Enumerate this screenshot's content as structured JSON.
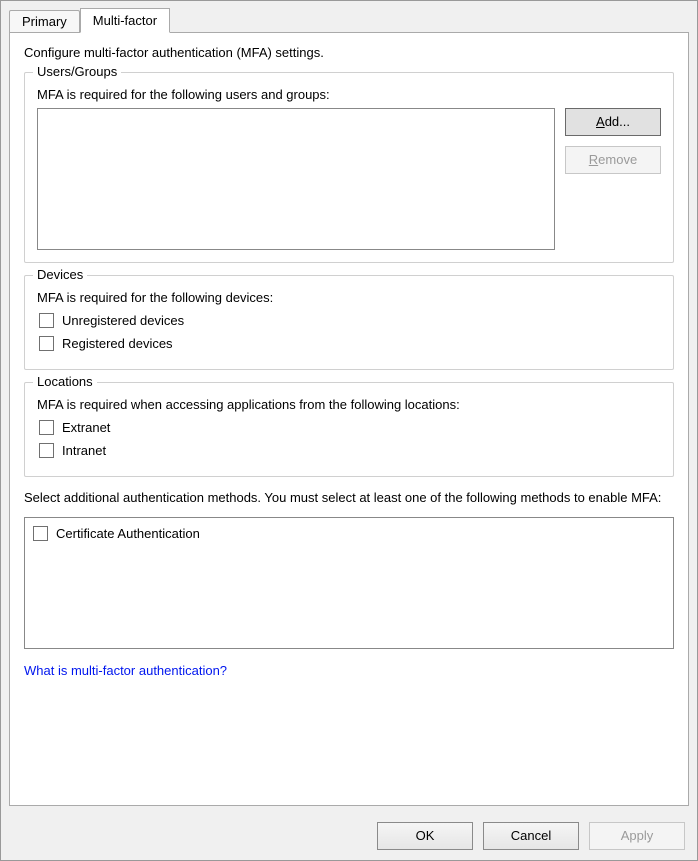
{
  "tabs": {
    "primary": "Primary",
    "multifactor": "Multi-factor"
  },
  "panel": {
    "description": "Configure multi-factor authentication (MFA) settings."
  },
  "users_groups": {
    "legend": "Users/Groups",
    "description": "MFA is required for the following users and groups:",
    "add_label_pre": "",
    "add_accel": "A",
    "add_label_post": "dd...",
    "remove_label_pre": "",
    "remove_accel": "R",
    "remove_label_post": "emove"
  },
  "devices": {
    "legend": "Devices",
    "description": "MFA is required for the following devices:",
    "unregistered_label": "Unregistered devices",
    "registered_label": "Registered devices"
  },
  "locations": {
    "legend": "Locations",
    "description": "MFA is required when accessing applications from the following locations:",
    "extranet_label": "Extranet",
    "intranet_label": "Intranet"
  },
  "methods": {
    "description": "Select additional authentication methods. You must select at least one of the following methods to enable MFA:",
    "cert_auth_label": "Certificate Authentication"
  },
  "link": {
    "label": "What is multi-factor authentication?"
  },
  "buttons": {
    "ok": "OK",
    "cancel": "Cancel",
    "apply": "Apply"
  }
}
